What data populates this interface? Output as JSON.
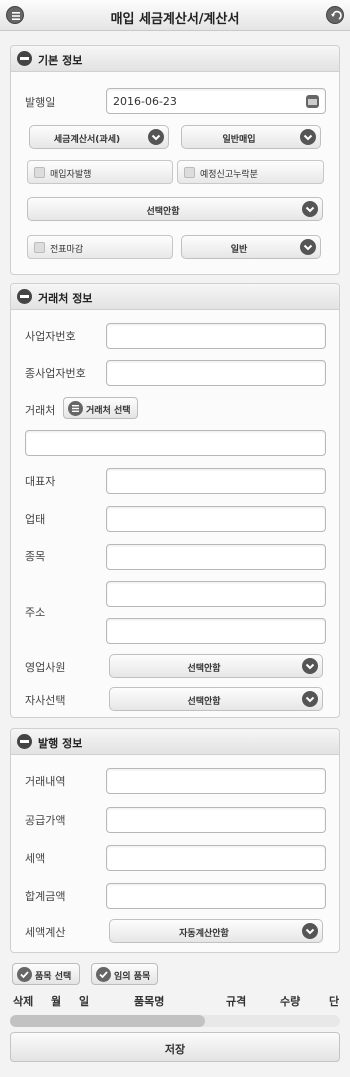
{
  "header": {
    "title": "매입 세금계산서/계산서",
    "menu_icon": "list-icon",
    "back_icon": "back-icon"
  },
  "basic": {
    "title": "기본 정보",
    "issue_date_label": "발행일",
    "issue_date_value": "2016-06-23",
    "invoice_type": "세금계산서(과세)",
    "purchase_type": "일반매입",
    "buyer_issue_label": "매입자발행",
    "scheduled_report_label": "예정신고누락분",
    "select1": "선택안함",
    "slip_close_label": "전표마감",
    "general_select": "일반"
  },
  "client": {
    "title": "거래처 정보",
    "biz_no_label": "사업자번호",
    "sub_biz_no_label": "종사업자번호",
    "client_label": "거래처",
    "client_select_button": "거래처 선택",
    "ceo_label": "대표자",
    "business_type_label": "업태",
    "business_item_label": "종목",
    "address_label": "주소",
    "sales_rep_label": "영업사원",
    "sales_rep_value": "선택안함",
    "company_select_label": "자사선택",
    "company_select_value": "선택안함"
  },
  "issue": {
    "title": "발행 정보",
    "trade_details_label": "거래내역",
    "supply_amount_label": "공급가액",
    "tax_label": "세액",
    "total_label": "합계금액",
    "tax_calc_label": "세액계산",
    "tax_calc_value": "자동계산안함"
  },
  "items": {
    "select_button": "품목 선택",
    "custom_button": "임의 품목",
    "columns": [
      "삭제",
      "월",
      "일",
      "품목명",
      "규격",
      "수량",
      "단"
    ]
  },
  "footer": {
    "save_label": "저장"
  }
}
